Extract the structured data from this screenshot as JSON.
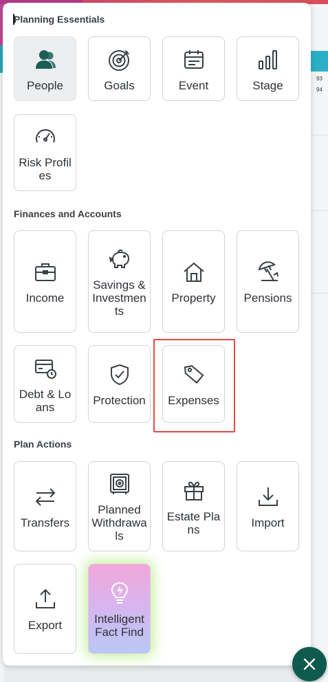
{
  "sections": [
    {
      "title": "Planning Essentials",
      "items": [
        {
          "label": "People",
          "icon": "people-icon",
          "active": true
        },
        {
          "label": "Goals",
          "icon": "target-icon"
        },
        {
          "label": "Event",
          "icon": "calendar-icon"
        },
        {
          "label": "Stage",
          "icon": "bar-chart-icon"
        },
        {
          "label": "Risk Profiles",
          "icon": "gauge-icon"
        }
      ]
    },
    {
      "title": "Finances and Accounts",
      "items": [
        {
          "label": "Income",
          "icon": "briefcase-icon"
        },
        {
          "label": "Savings & Investments",
          "icon": "piggy-bank-icon"
        },
        {
          "label": "Property",
          "icon": "house-icon"
        },
        {
          "label": "Pensions",
          "icon": "beach-umbrella-icon"
        },
        {
          "label": "Debt & Loans",
          "icon": "card-clock-icon"
        },
        {
          "label": "Protection",
          "icon": "shield-check-icon"
        },
        {
          "label": "Expenses",
          "icon": "price-tag-icon",
          "highlighted": true
        }
      ]
    },
    {
      "title": "Plan Actions",
      "items": [
        {
          "label": "Transfers",
          "icon": "transfer-arrows-icon"
        },
        {
          "label": "Planned Withdrawals",
          "icon": "safe-icon"
        },
        {
          "label": "Estate Plans",
          "icon": "gift-icon"
        },
        {
          "label": "Import",
          "icon": "download-icon"
        },
        {
          "label": "Export",
          "icon": "upload-icon"
        },
        {
          "label": "Intelligent Fact Find",
          "icon": "lightbulb-bolt-icon",
          "ai": true
        }
      ]
    }
  ],
  "background_numbers": [
    "93",
    "94"
  ],
  "colors": {
    "accent": "#0f5a4f",
    "highlight_border": "#e04848",
    "tile_border": "#cfd3d8",
    "people_icon": "#1b5e55"
  }
}
